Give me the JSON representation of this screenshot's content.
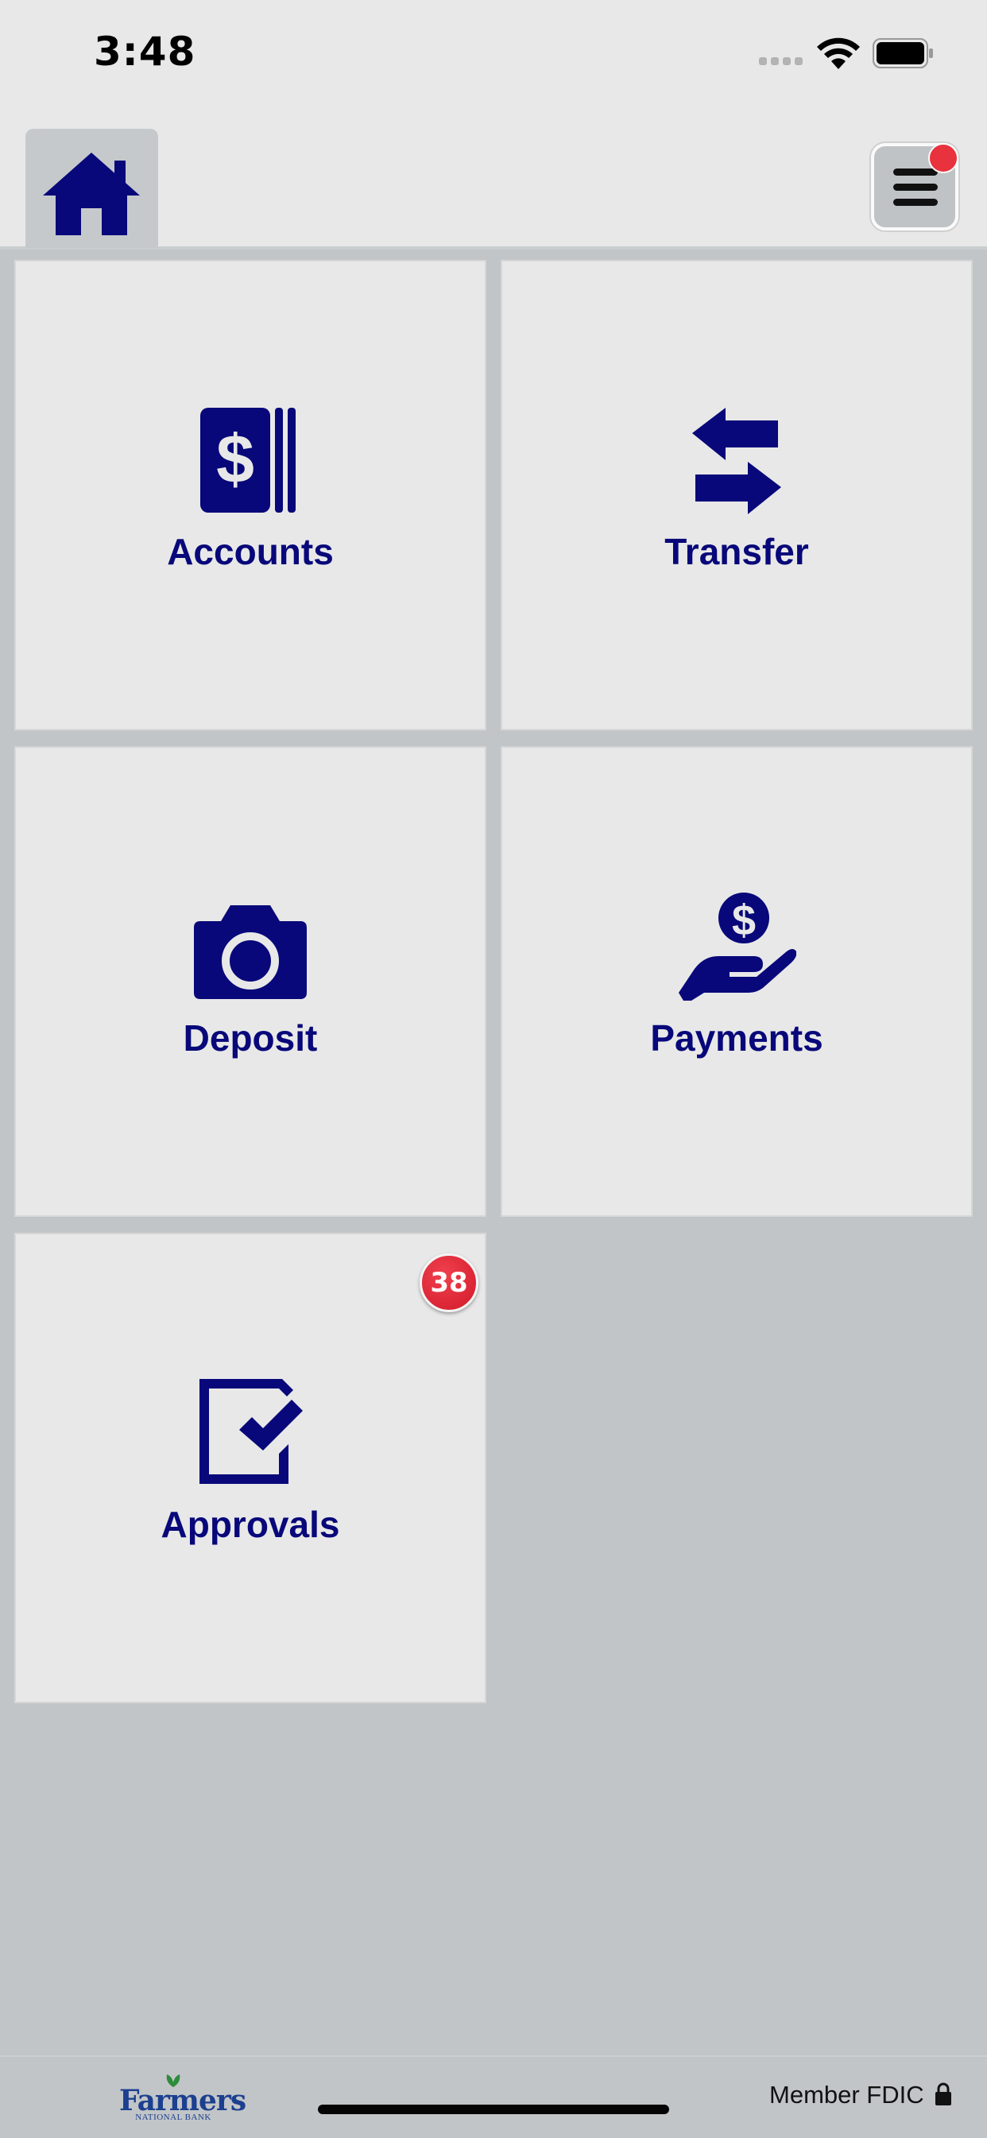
{
  "status_bar": {
    "time": "3:48"
  },
  "header": {
    "home_icon": "home-icon",
    "menu_icon": "hamburger-menu-icon",
    "menu_notification": true
  },
  "tiles": [
    {
      "label": "Accounts",
      "icon": "dollar-cards-icon"
    },
    {
      "label": "Transfer",
      "icon": "transfer-arrows-icon"
    },
    {
      "label": "Deposit",
      "icon": "camera-icon"
    },
    {
      "label": "Payments",
      "icon": "hand-coin-icon"
    },
    {
      "label": "Approvals",
      "icon": "checkbox-icon",
      "badge": "38"
    }
  ],
  "footer": {
    "logo_text": "Farmers",
    "logo_subtext": "NATIONAL BANK",
    "member_text": "Member FDIC",
    "lock_icon": "lock-icon"
  },
  "colors": {
    "brand": "#08087a",
    "tile_bg": "#e8e8e8",
    "page_bg": "#c1c5c8",
    "badge": "#d11a29",
    "logo": "#1c3f8f"
  }
}
